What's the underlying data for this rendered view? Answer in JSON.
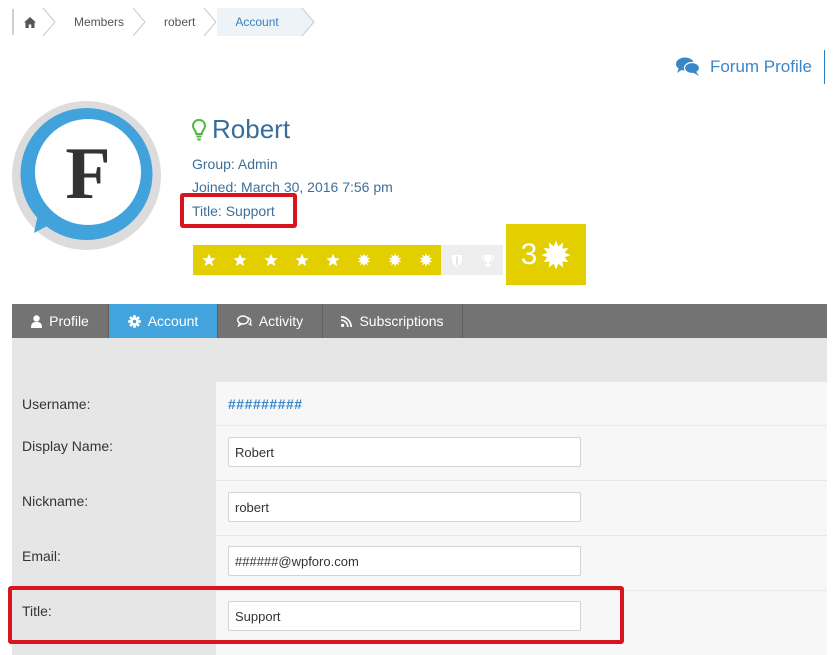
{
  "breadcrumb": {
    "items": [
      "Members",
      "robert",
      "Account"
    ]
  },
  "forum_profile": {
    "label": "Forum Profile"
  },
  "profile": {
    "name": "Robert",
    "group": "Group: Admin",
    "joined": "Joined: March 30, 2016 7:56 pm",
    "title": "Title: Support",
    "avatar_letter": "F",
    "level": "3",
    "rating_filled": 8,
    "rating_total": 10
  },
  "tabs": [
    "Profile",
    "Account",
    "Activity",
    "Subscriptions"
  ],
  "form": {
    "username_label": "Username:",
    "username_value": "#########",
    "display_name_label": "Display Name:",
    "display_name_value": "Robert",
    "nickname_label": "Nickname:",
    "nickname_value": "robert",
    "email_label": "Email:",
    "email_value": "######@wpforo.com",
    "title_label": "Title:",
    "title_value": "Support"
  },
  "colors": {
    "accent": "#43a3dc",
    "rating": "#e3cf00",
    "highlight": "#d8141c",
    "online": "#4cbb3c"
  }
}
